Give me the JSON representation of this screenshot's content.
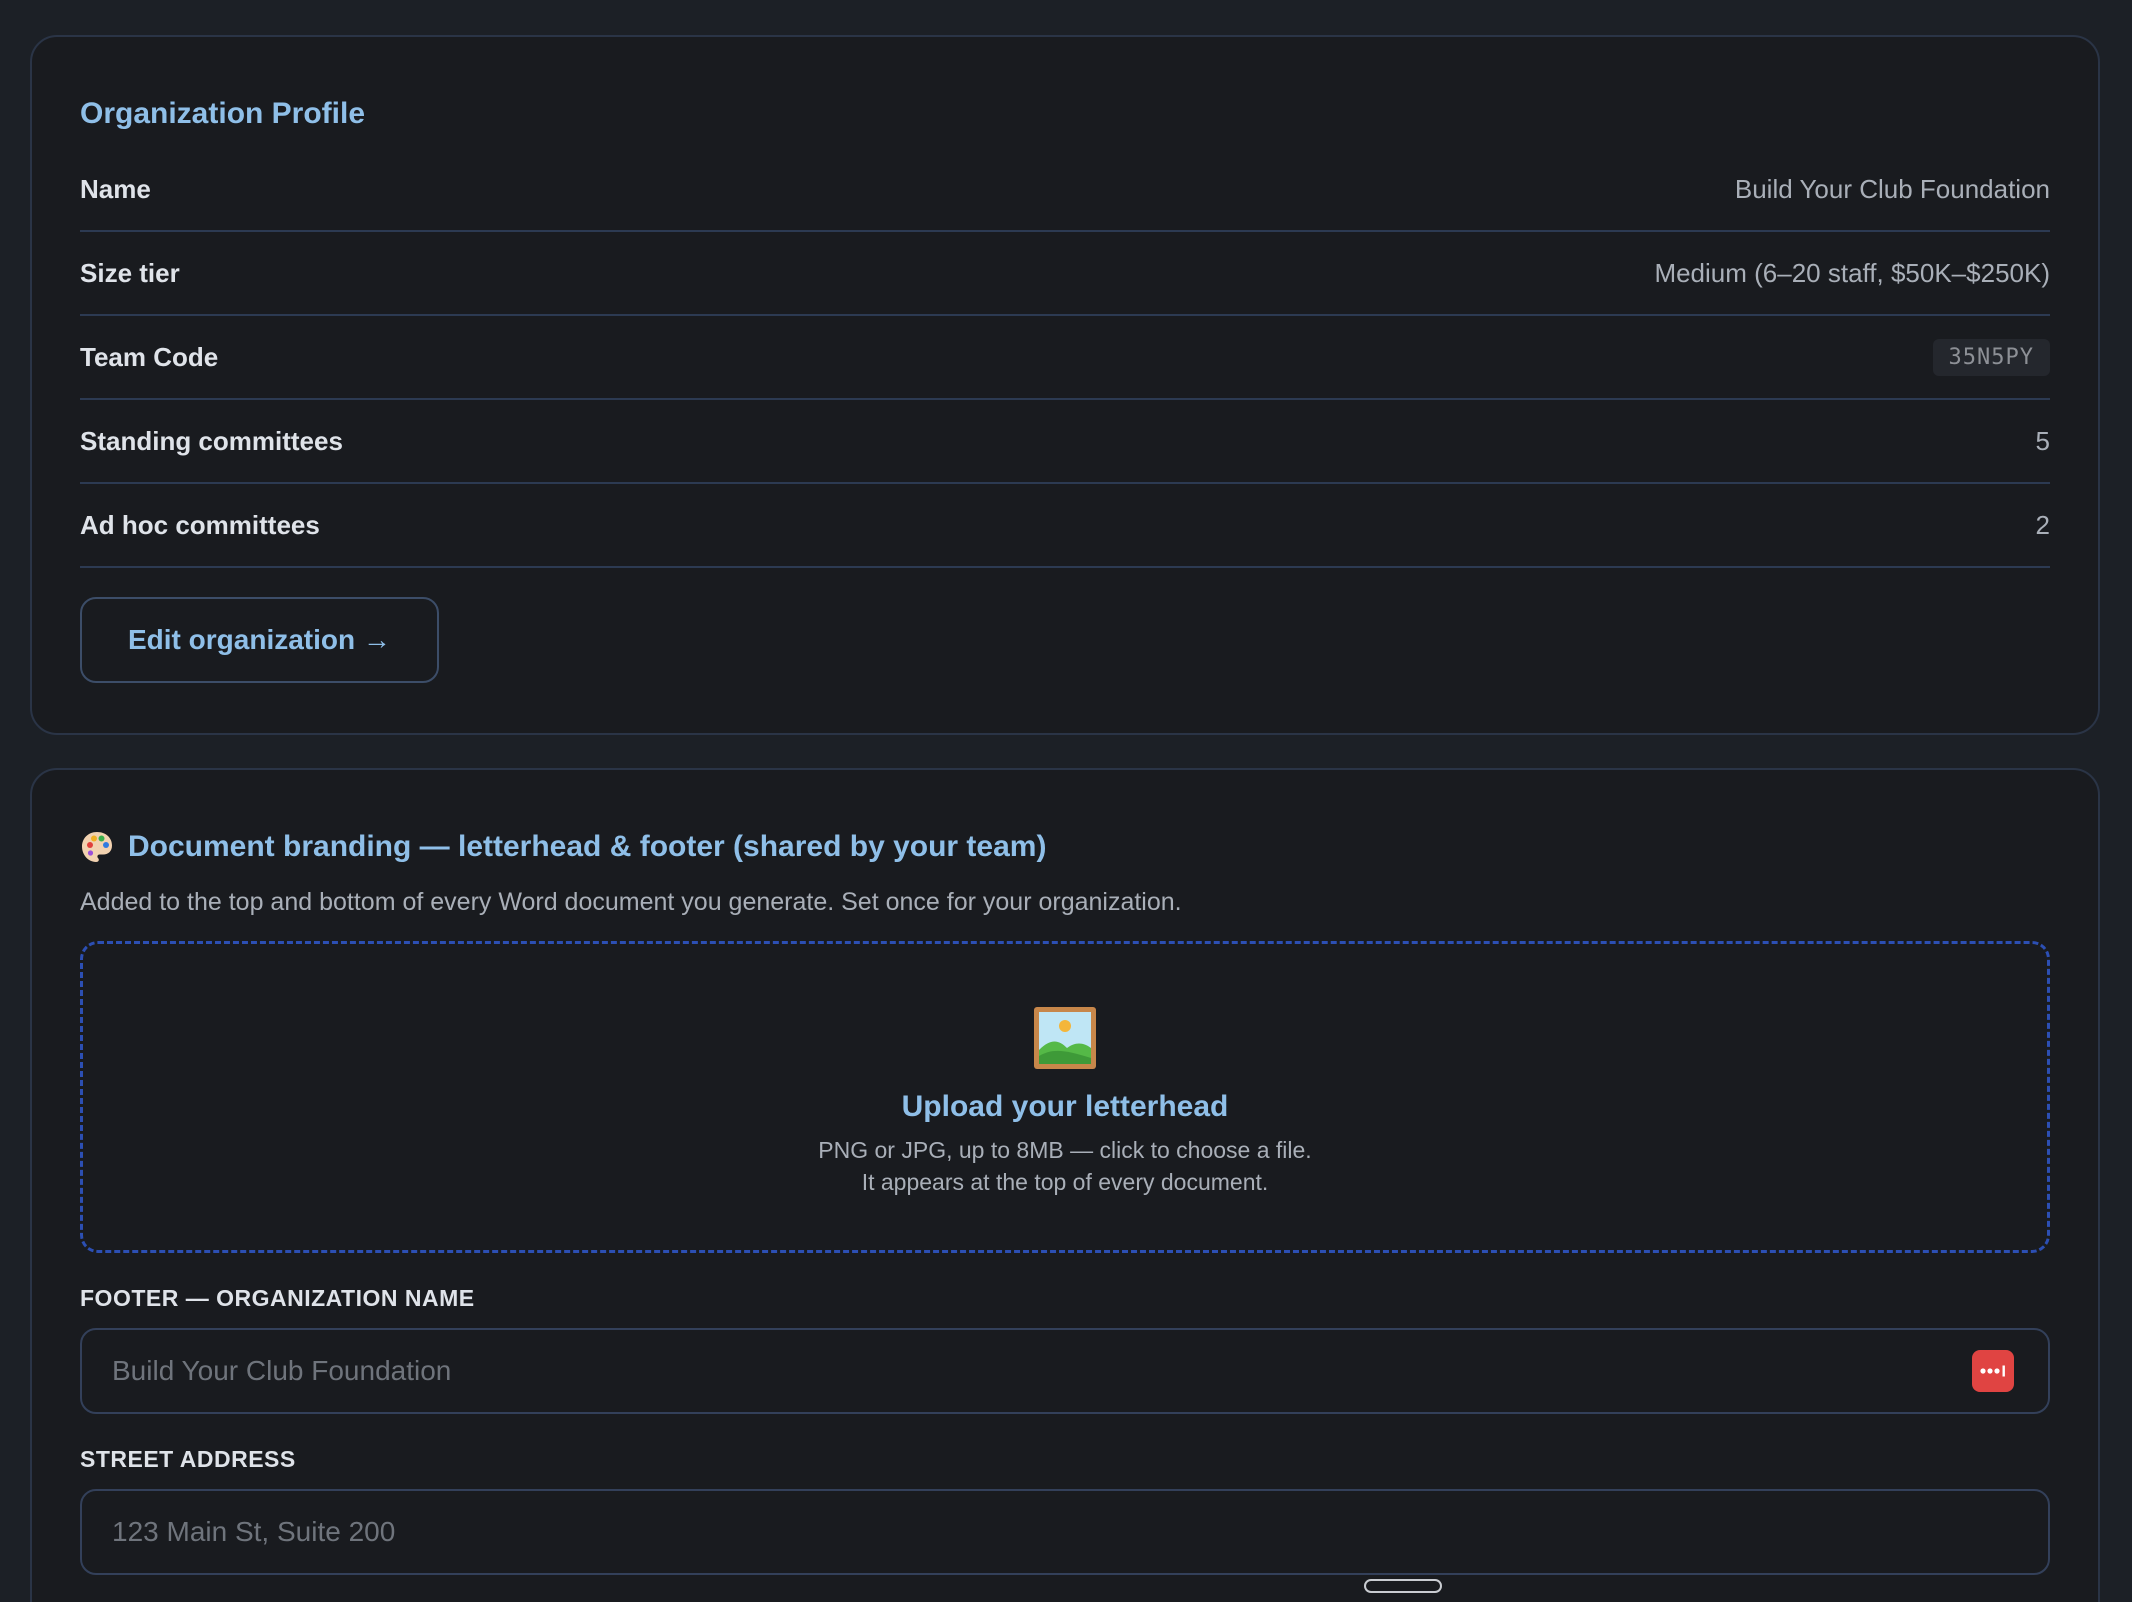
{
  "profile": {
    "title": "Organization Profile",
    "rows": [
      {
        "label": "Name",
        "value": "Build Your Club Foundation"
      },
      {
        "label": "Size tier",
        "value": "Medium (6–20 staff, $50K–$250K)"
      },
      {
        "label": "Team Code",
        "value": "35N5PY"
      },
      {
        "label": "Standing committees",
        "value": "5"
      },
      {
        "label": "Ad hoc committees",
        "value": "2"
      }
    ],
    "edit_label": "Edit organization →"
  },
  "branding": {
    "icon": "palette-icon",
    "title": "Document branding — letterhead & footer (shared by your team)",
    "description": "Added to the top and bottom of every Word document you generate. Set once for your organization.",
    "upload": {
      "icon": "framed-picture-icon",
      "title": "Upload your letterhead",
      "line1": "PNG or JPG, up to 8MB — click to choose a file.",
      "line2": "It appears at the top of every document."
    },
    "footer_name": {
      "label": "FOOTER — ORGANIZATION NAME",
      "placeholder": "Build Your Club Foundation",
      "value": ""
    },
    "street": {
      "label": "STREET ADDRESS",
      "placeholder": "123 Main St, Suite 200",
      "value": ""
    }
  },
  "colors": {
    "accent": "#8fbfe8",
    "dropzone_border": "#2c4fb3",
    "password_manager_badge": "#e04442"
  }
}
